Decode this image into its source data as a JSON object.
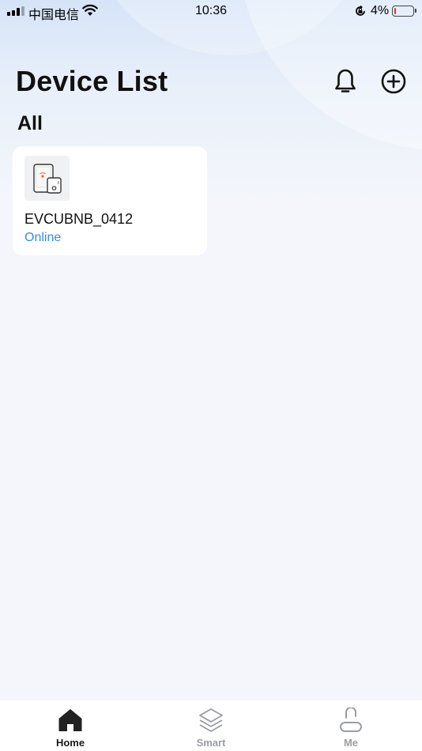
{
  "status_bar": {
    "carrier": "中国电信",
    "time": "10:36",
    "battery_percent": "4%",
    "battery_level": 0.04,
    "icons": [
      "signal-icon",
      "wifi-icon",
      "rotation-lock-icon",
      "battery-icon"
    ]
  },
  "header": {
    "title": "Device List",
    "icons": [
      "bell-icon",
      "add-circle-icon"
    ]
  },
  "filter": {
    "label": "All"
  },
  "devices": [
    {
      "name": "EVCUBNB_0412",
      "status": "Online",
      "icon": "device-icon"
    }
  ],
  "colors": {
    "online": "#2f8fe6",
    "tab_active": "#1a1a1a",
    "tab_inactive": "#9a9da3",
    "background": "#f4f6fb"
  },
  "tab_bar": {
    "tabs": [
      {
        "label": "Home",
        "icon": "home-icon",
        "active": true
      },
      {
        "label": "Smart",
        "icon": "layers-icon",
        "active": false
      },
      {
        "label": "Me",
        "icon": "person-icon",
        "active": false
      }
    ]
  }
}
